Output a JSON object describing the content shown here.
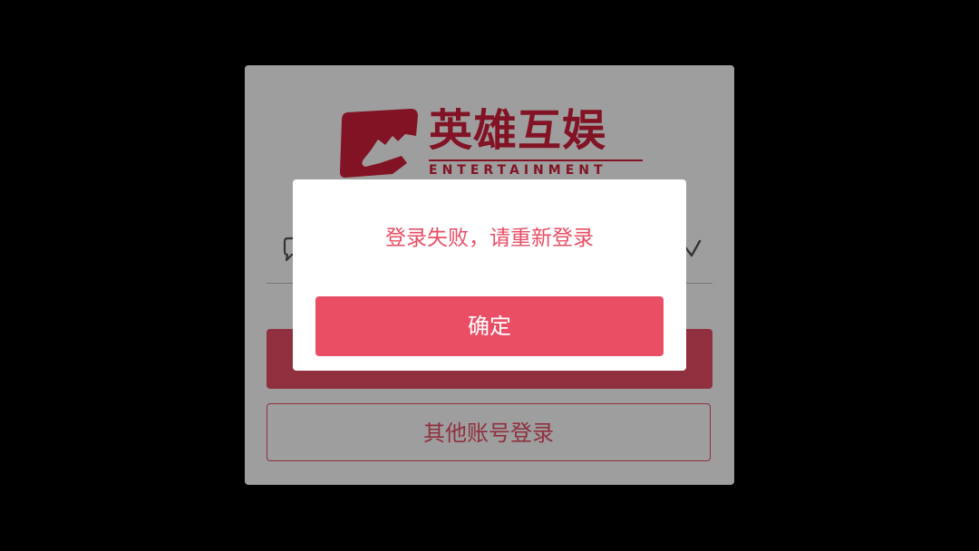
{
  "brand": {
    "name_cn": "英雄互娱",
    "name_en": "ENTERTAINMENT",
    "color": "#d21f3a"
  },
  "login": {
    "left_icon": "chat-bubble-icon",
    "right_icon": "chevron-icon",
    "primary_button_label": "",
    "other_login_label": "其他账号登录"
  },
  "dialog": {
    "message": "登录失败，请重新登录",
    "confirm_label": "确定",
    "accent_color": "#e94e65"
  }
}
